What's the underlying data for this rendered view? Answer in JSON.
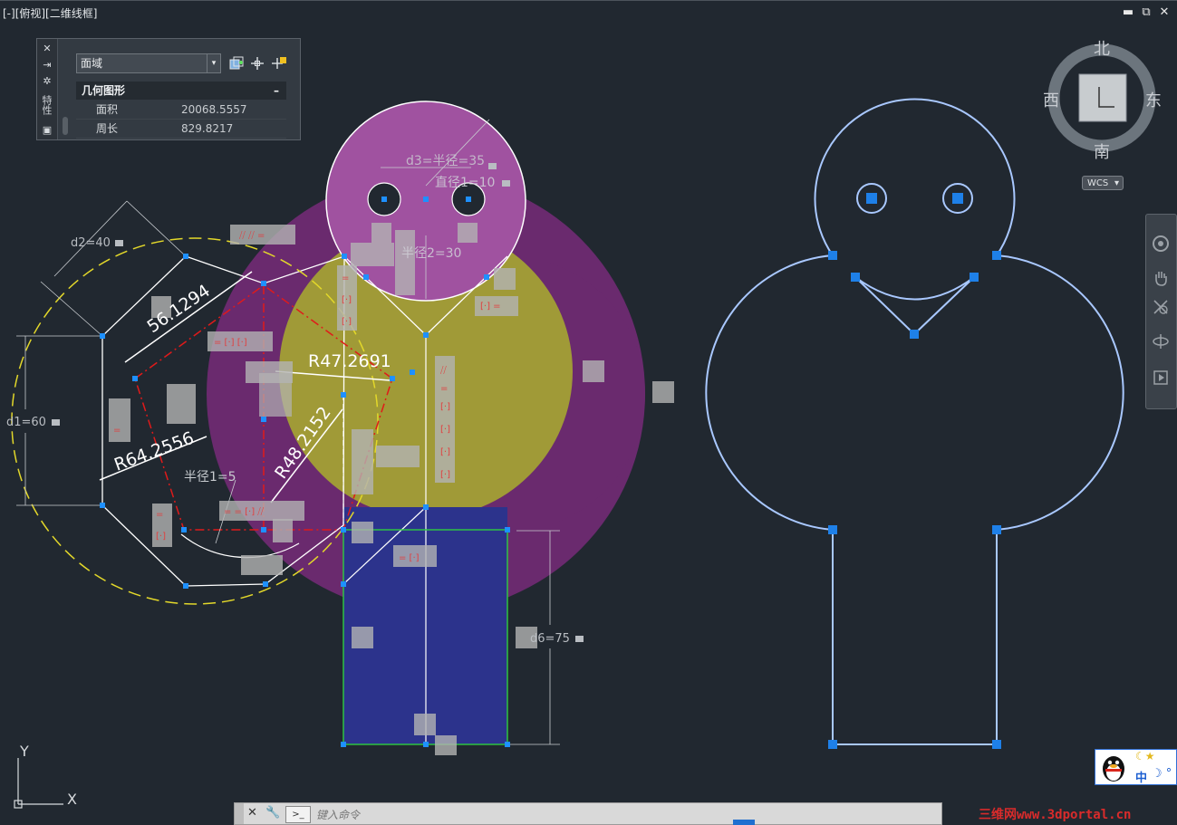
{
  "viewport": {
    "label": "[-][俯视][二维线框]"
  },
  "window_controls": {
    "minimize": "▬",
    "restore": "⧉",
    "close": "✕"
  },
  "properties_palette": {
    "object_type": "面域",
    "strip_label": "特性",
    "section_title": "几何图形",
    "collapse_symbol": "–",
    "rows": [
      {
        "key": "面积",
        "value": "20068.5557"
      },
      {
        "key": "周长",
        "value": "829.8217"
      }
    ],
    "icons": [
      "quick-select-icon",
      "select-objects-icon",
      "toggle-pickadd-icon"
    ]
  },
  "viewcube": {
    "north": "北",
    "south": "南",
    "east": "东",
    "west": "西",
    "wcs_label": "WCS"
  },
  "drawing": {
    "dimensions": {
      "d1": "d1=60",
      "d2": "d2=40",
      "d3": "d3=半径=35",
      "diam": "直径1=10",
      "r2": "半径2=30",
      "r1": "半径1=5",
      "d6": "d6=75"
    },
    "measurements": {
      "chord": "56.1294",
      "r_a": "R47.2691",
      "r_b": "R48.2152",
      "r_c": "R64.2556"
    },
    "ucs": {
      "x": "X",
      "y": "Y"
    }
  },
  "command_line": {
    "placeholder": "键入命令",
    "prompt_icon": ">_"
  },
  "ime": {
    "label": "中"
  },
  "watermark": "三维网www.3dportal.cn",
  "colors": {
    "background": "#212830",
    "magenta": "#a052a0",
    "purple": "#6a2a6e",
    "olive": "#a09a37",
    "navy": "#2c338c",
    "grip": "#1e80e8",
    "outline": "#a9c8ff"
  }
}
